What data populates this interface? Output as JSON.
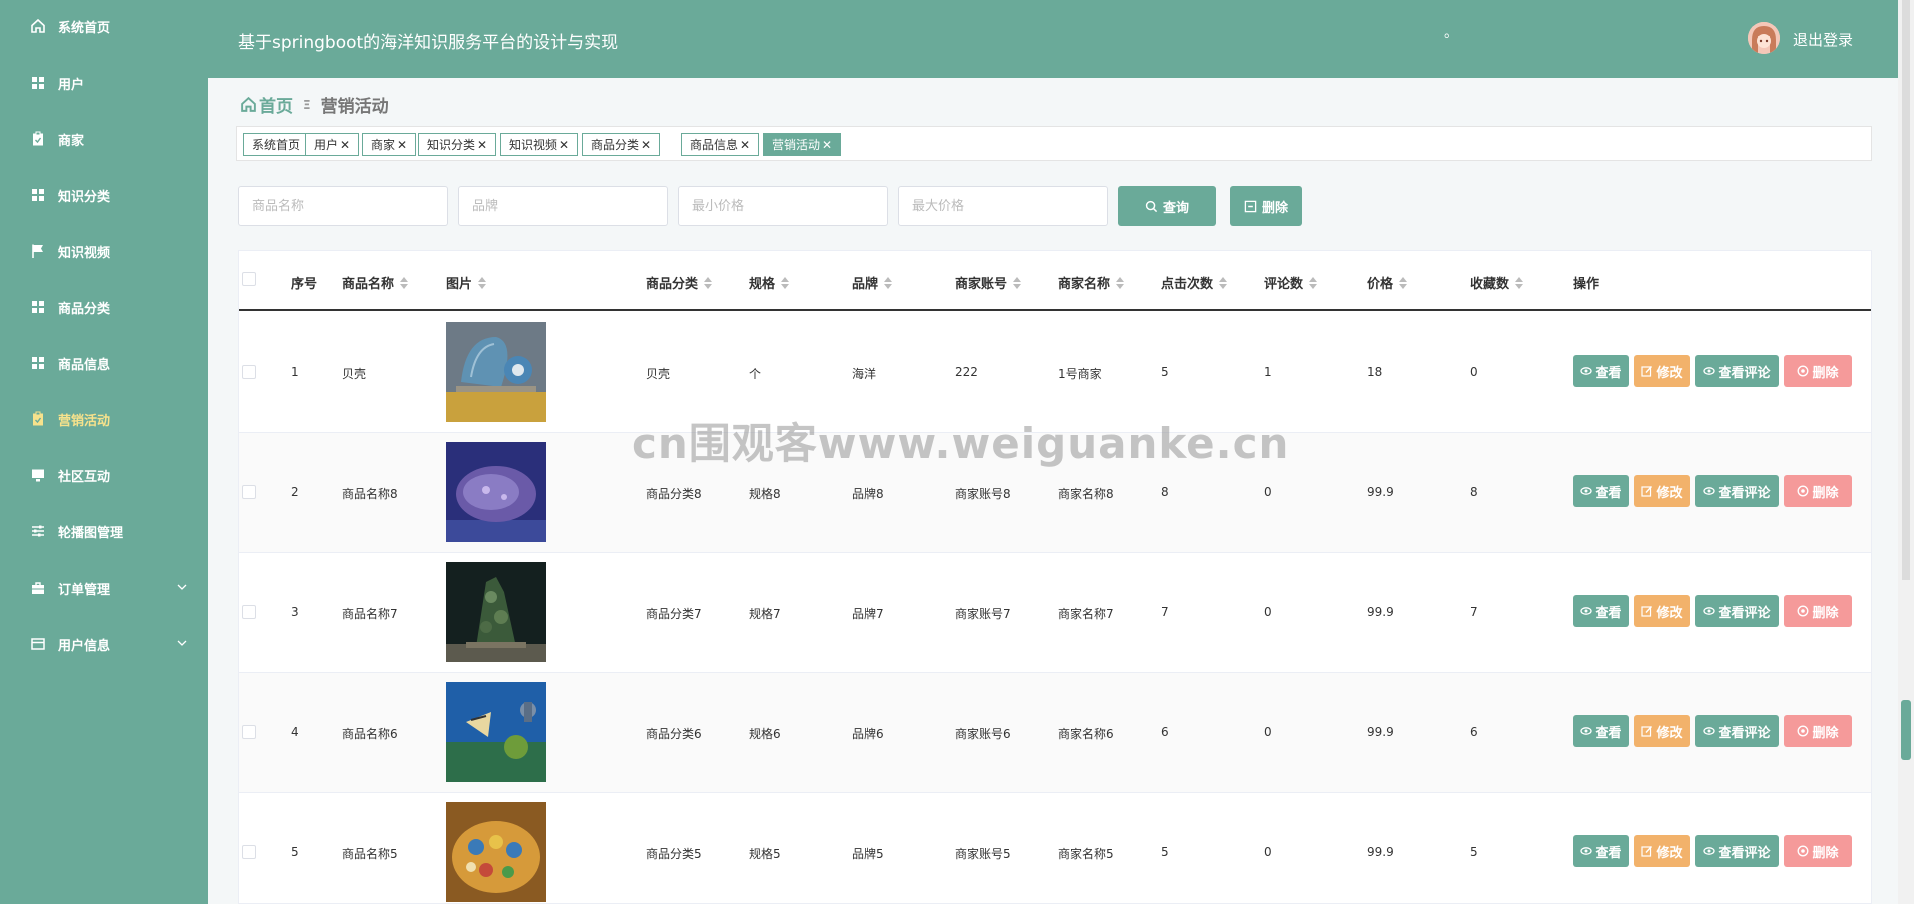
{
  "app": {
    "title": "基于springboot的海洋知识服务平台的设计与实现",
    "dot": "。",
    "logout_label": "退出登录"
  },
  "sidebar": {
    "items": [
      {
        "label": "系统首页",
        "icon": "home-icon"
      },
      {
        "label": "用户",
        "icon": "grid-icon"
      },
      {
        "label": "商家",
        "icon": "clipboard-icon"
      },
      {
        "label": "知识分类",
        "icon": "grid-icon"
      },
      {
        "label": "知识视频",
        "icon": "flag-icon"
      },
      {
        "label": "商品分类",
        "icon": "grid-icon"
      },
      {
        "label": "商品信息",
        "icon": "grid-icon"
      },
      {
        "label": "营销活动",
        "icon": "clipboard-icon",
        "active": true
      },
      {
        "label": "社区互动",
        "icon": "monitor-icon"
      },
      {
        "label": "轮播图管理",
        "icon": "sliders-icon"
      },
      {
        "label": "订单管理",
        "icon": "briefcase-icon",
        "expandable": true
      },
      {
        "label": "用户信息",
        "icon": "card-icon",
        "expandable": true
      }
    ]
  },
  "breadcrumb": {
    "home": "首页",
    "sep": "Ξ",
    "current": "营销活动"
  },
  "tags": [
    {
      "label": "系统首页",
      "closable": false
    },
    {
      "label": "用户",
      "closable": true
    },
    {
      "label": "商家",
      "closable": true
    },
    {
      "label": "知识分类",
      "closable": true
    },
    {
      "label": "知识视频",
      "closable": true
    },
    {
      "label": "商品分类",
      "closable": true
    },
    {
      "label": "商品信息",
      "closable": true
    },
    {
      "label": "营销活动",
      "closable": true,
      "active": true
    }
  ],
  "search": {
    "name_placeholder": "商品名称",
    "brand_placeholder": "品牌",
    "min_price_placeholder": "最小价格",
    "max_price_placeholder": "最大价格",
    "query_label": "查询",
    "delete_label": "删除"
  },
  "table": {
    "columns": [
      "序号",
      "商品名称",
      "图片",
      "商品分类",
      "规格",
      "品牌",
      "商家账号",
      "商家名称",
      "点击次数",
      "评论数",
      "价格",
      "收藏数",
      "操作"
    ],
    "rows": [
      {
        "index": "1",
        "name": "贝壳",
        "category": "贝壳",
        "spec": "个",
        "brand": "海洋",
        "merchant_account": "222",
        "merchant_name": "1号商家",
        "clicks": "5",
        "comments": "1",
        "price": "18",
        "favorites": "0"
      },
      {
        "index": "2",
        "name": "商品名称8",
        "category": "商品分类8",
        "spec": "规格8",
        "brand": "品牌8",
        "merchant_account": "商家账号8",
        "merchant_name": "商家名称8",
        "clicks": "8",
        "comments": "0",
        "price": "99.9",
        "favorites": "8"
      },
      {
        "index": "3",
        "name": "商品名称7",
        "category": "商品分类7",
        "spec": "规格7",
        "brand": "品牌7",
        "merchant_account": "商家账号7",
        "merchant_name": "商家名称7",
        "clicks": "7",
        "comments": "0",
        "price": "99.9",
        "favorites": "7"
      },
      {
        "index": "4",
        "name": "商品名称6",
        "category": "商品分类6",
        "spec": "规格6",
        "brand": "品牌6",
        "merchant_account": "商家账号6",
        "merchant_name": "商家名称6",
        "clicks": "6",
        "comments": "0",
        "price": "99.9",
        "favorites": "6"
      },
      {
        "index": "5",
        "name": "商品名称5",
        "category": "商品分类5",
        "spec": "规格5",
        "brand": "品牌5",
        "merchant_account": "商家账号5",
        "merchant_name": "商家名称5",
        "clicks": "5",
        "comments": "0",
        "price": "99.9",
        "favorites": "5"
      }
    ],
    "actions": {
      "view": "查看",
      "edit": "修改",
      "view_comments": "查看评论",
      "delete": "删除"
    }
  },
  "watermark": "cn围观客www.weiguanke.cn",
  "colors": {
    "primary": "#6aaa99",
    "edit": "#f2b26b",
    "delete": "#f59a9a",
    "active_nav": "#f7e28c"
  }
}
